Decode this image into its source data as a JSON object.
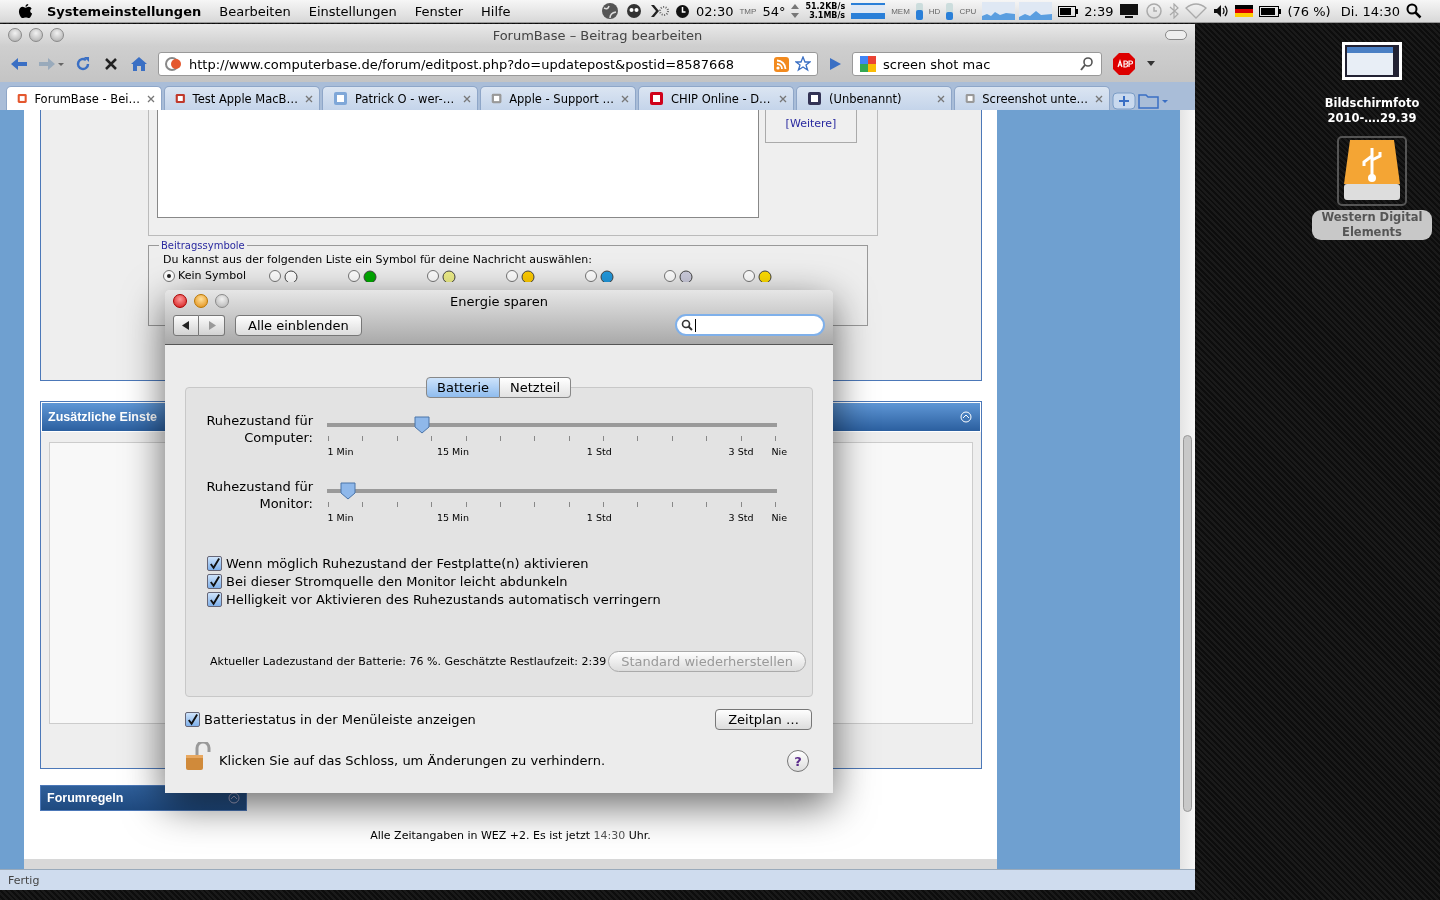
{
  "menubar": {
    "app": "Systemeinstellungen",
    "menus": [
      "Bearbeiten",
      "Einstellungen",
      "Fenster",
      "Hilfe"
    ],
    "status": {
      "timer": "02:30",
      "tmp_label": "TMP",
      "temperature": "54°",
      "net_up": "51.2KB/s",
      "net_down": "3.1MB/s",
      "mem_label": "MEM",
      "hd_label": "HD",
      "cpu_label": "CPU",
      "time_left": "2:39",
      "battery": "(76 %)",
      "clock": "Di. 14:30"
    }
  },
  "browser": {
    "title": "ForumBase – Beitrag bearbeiten",
    "url": "http://www.computerbase.de/forum/editpost.php?do=updatepost&postid=8587668",
    "search": "screen shot mac",
    "tabs": [
      {
        "label": "ForumBase - Bei…",
        "selected": true
      },
      {
        "label": "Test Apple MacB…",
        "selected": false
      },
      {
        "label": "Patrick O - wer-…",
        "selected": false
      },
      {
        "label": "Apple - Support …",
        "selected": false
      },
      {
        "label": "CHIP Online - D…",
        "selected": false
      },
      {
        "label": "(Unbenannt)",
        "selected": false
      },
      {
        "label": "Screenshot unte…",
        "selected": false
      }
    ],
    "page": {
      "more_link": "[Weitere]",
      "symbols_legend": "Beitragssymbole",
      "symbols_text": "Du kannst aus der folgenden Liste ein Symbol für deine Nachricht auswählen:",
      "symbols": [
        {
          "label": "Kein Symbol",
          "selected": true
        },
        {
          "selected": false
        },
        {
          "selected": false
        },
        {
          "selected": false
        },
        {
          "selected": false
        },
        {
          "selected": false
        },
        {
          "selected": false
        },
        {
          "selected": false
        }
      ],
      "extra_header": "Zusätzliche Einste",
      "rules_header": "Forumregeln",
      "footer": "Alle Zeitangaben in WEZ +2. Es ist jetzt",
      "footer_time": "14:30",
      "footer_end": "Uhr."
    },
    "status_text": "Fertig"
  },
  "dialog": {
    "title": "Energie sparen",
    "show_all": "Alle einblenden",
    "segments": [
      {
        "label": "Batterie",
        "selected": true
      },
      {
        "label": "Netzteil",
        "selected": false
      }
    ],
    "sliders": [
      {
        "label": "Ruhezustand für Computer:",
        "level": 0.21,
        "ticks": [
          "1 Min",
          "15 Min",
          "1 Std",
          "3 Std",
          "Nie"
        ]
      },
      {
        "label": "Ruhezustand für Monitor:",
        "level": 0.047,
        "ticks": [
          "1 Min",
          "15 Min",
          "1 Std",
          "3 Std",
          "Nie"
        ]
      }
    ],
    "checkboxes": [
      {
        "label": "Wenn möglich Ruhezustand der Festplatte(n) aktivieren",
        "checked": true
      },
      {
        "label": "Bei dieser Stromquelle den Monitor leicht abdunkeln",
        "checked": true
      },
      {
        "label": "Helligkeit vor Aktivieren des Ruhezustands automatisch verringern",
        "checked": true
      }
    ],
    "battery_info": "Aktueller Ladezustand der Batterie: 76 %. Geschätzte Restlaufzeit: 2:39",
    "restore_button": "Standard wiederherstellen",
    "menu_checkbox": {
      "label": "Batteriestatus in der Menüleiste anzeigen",
      "checked": true
    },
    "schedule_button": "Zeitplan …",
    "lock_text": "Klicken Sie auf das Schloss, um Änderungen zu verhindern.",
    "help": "?"
  },
  "desktop": {
    "icons": [
      {
        "lines": [
          "Bildschirmfoto",
          "2010-….29.39"
        ]
      },
      {
        "lines": [
          "Western Digital",
          "Elements"
        ]
      }
    ]
  }
}
